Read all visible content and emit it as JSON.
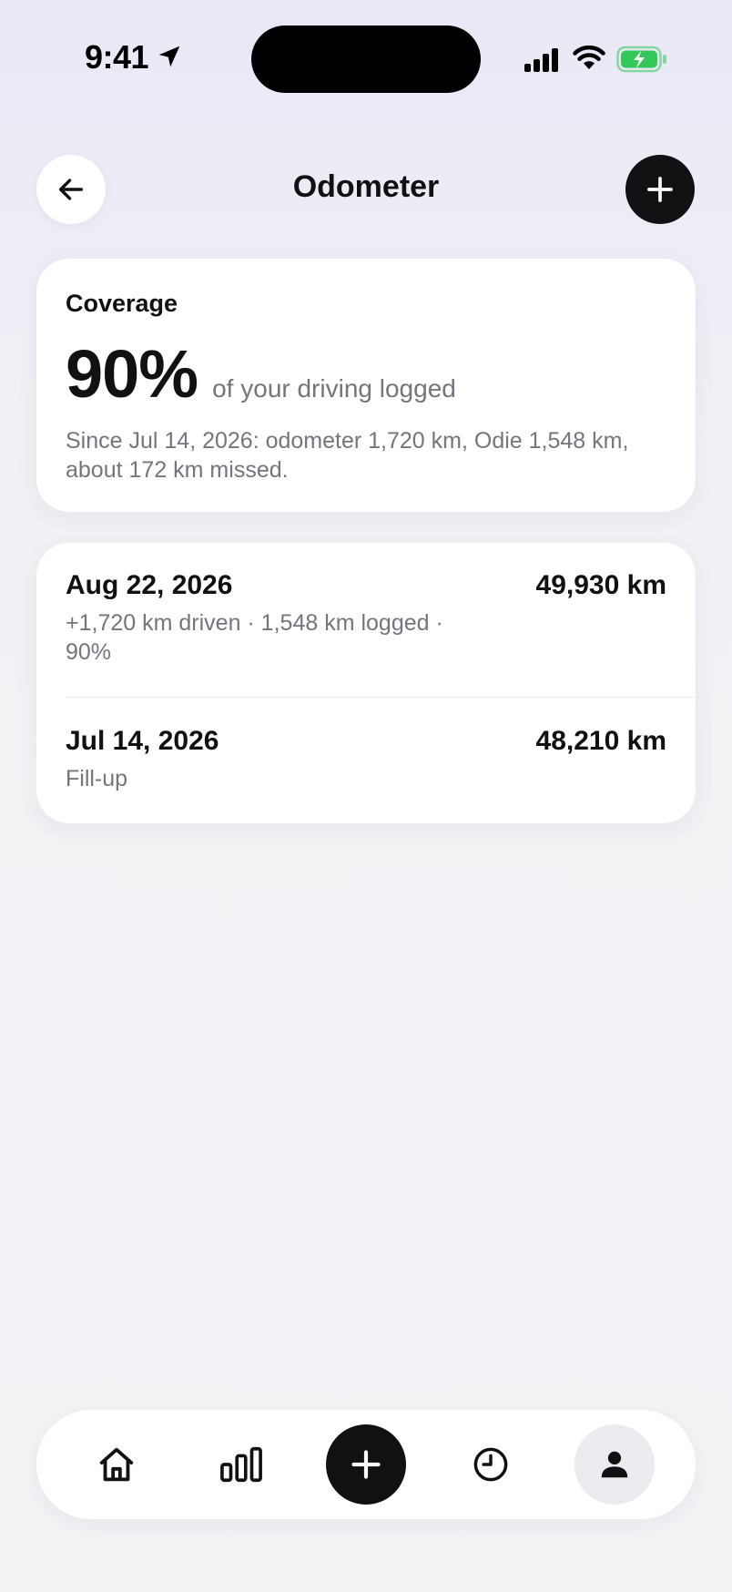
{
  "status_bar": {
    "time": "9:41",
    "icons": [
      "location-arrow-icon",
      "cellular-signal-icon",
      "wifi-icon",
      "battery-charging-icon"
    ],
    "battery_color": "#34c759"
  },
  "header": {
    "title": "Odometer",
    "back_icon": "arrow-left-icon",
    "add_icon": "plus-icon"
  },
  "coverage": {
    "label": "Coverage",
    "value": "90%",
    "subtitle": "of your driving logged",
    "detail": "Since Jul 14, 2026: odometer 1,720 km, Odie 1,548 km, about 172 km missed."
  },
  "readings": [
    {
      "date": "Aug 22, 2026",
      "odometer": "49,930 km",
      "detail": "+1,720 km driven · 1,548 km logged · 90%"
    },
    {
      "date": "Jul 14, 2026",
      "odometer": "48,210 km",
      "detail": "Fill-up"
    }
  ],
  "bottom_nav": {
    "items": [
      {
        "icon": "home-icon",
        "active": false
      },
      {
        "icon": "bar-chart-icon",
        "active": false
      },
      {
        "icon": "plus-icon",
        "active": false
      },
      {
        "icon": "clock-icon",
        "active": false
      },
      {
        "icon": "person-icon",
        "active": true
      }
    ]
  },
  "colors": {
    "accent": "#111114",
    "muted_text": "#74757d",
    "card": "#ffffff",
    "active_nav_bg": "#ebebf0"
  }
}
